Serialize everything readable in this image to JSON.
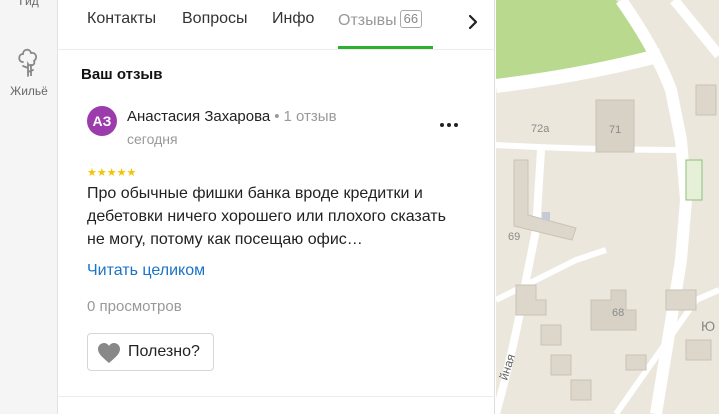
{
  "rail": {
    "guide_label": "Гид",
    "housing_label": "Жильё"
  },
  "tabs": [
    {
      "label": "Контакты"
    },
    {
      "label": "Вопросы"
    },
    {
      "label": "Инфо"
    },
    {
      "label": "Отзывы",
      "badge": "66",
      "active": true
    }
  ],
  "section_title": "Ваш отзыв",
  "review": {
    "avatar_initials": "АЗ",
    "avatar_color": "#9c3cac",
    "author": "Анастасия Захарова",
    "separator": "•",
    "review_count": "1 отзыв",
    "date": "сегодня",
    "rating": 5,
    "stars": "★★★★★",
    "text": "Про обычные фишки банка вроде кредитки и дебетовки ничего хорошего или плохого сказать не могу, потому как посещаю офис…",
    "read_more": "Читать целиком",
    "views": "0 просмотров",
    "helpful_label": "Полезно?"
  },
  "map": {
    "labels": [
      "72а",
      "71",
      "69",
      "68",
      "Ю",
      "йная"
    ]
  },
  "colors": {
    "accent_green": "#2db02d",
    "link_blue": "#1a73c8",
    "star_yellow": "#f5c400"
  }
}
